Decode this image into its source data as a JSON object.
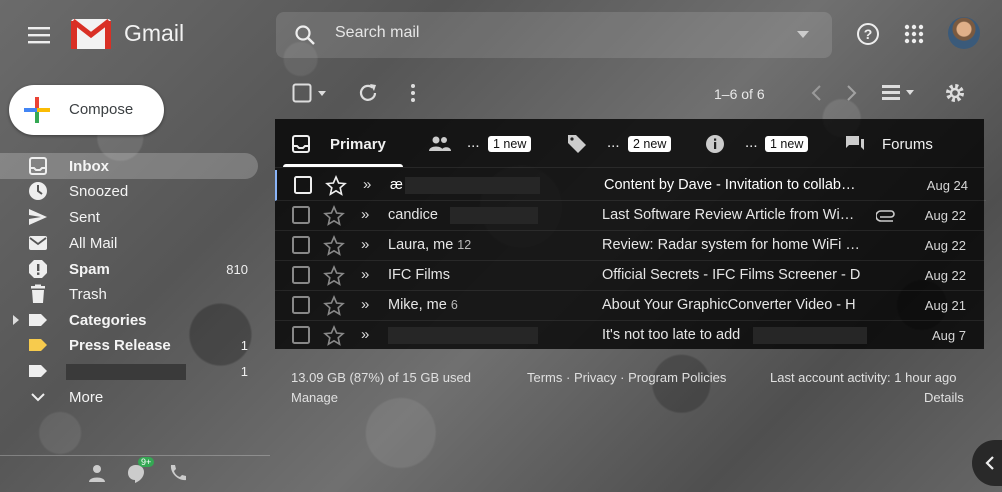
{
  "header": {
    "brand": "Gmail",
    "search_placeholder": "Search mail",
    "icons": [
      "menu-icon",
      "gmail-logo",
      "search-icon",
      "search-options-icon",
      "help-icon",
      "apps-icon",
      "avatar"
    ]
  },
  "compose": {
    "label": "Compose"
  },
  "sidebar": {
    "items": [
      {
        "label": "Inbox",
        "icon": "inbox-icon",
        "bold": true,
        "active": true,
        "count": ""
      },
      {
        "label": "Snoozed",
        "icon": "clock-icon",
        "bold": false,
        "count": ""
      },
      {
        "label": "Sent",
        "icon": "send-icon",
        "bold": false,
        "count": ""
      },
      {
        "label": "All Mail",
        "icon": "mail-icon",
        "bold": false,
        "count": ""
      },
      {
        "label": "Spam",
        "icon": "spam-icon",
        "bold": true,
        "count": "810"
      },
      {
        "label": "Trash",
        "icon": "trash-icon",
        "bold": false,
        "count": ""
      },
      {
        "label": "Categories",
        "icon": "label-icon",
        "bold": true,
        "count": ""
      },
      {
        "label": "Press Release",
        "icon": "label-icon",
        "bold": true,
        "count": "1",
        "color": "#f7cb4d"
      },
      {
        "label": "",
        "icon": "label-icon",
        "bold": false,
        "count": "1",
        "redacted": true
      },
      {
        "label": "More",
        "icon": "chevron-down-icon",
        "bold": false,
        "count": ""
      }
    ]
  },
  "toolbar": {
    "pager": "1–6 of 6"
  },
  "tabs": [
    {
      "label": "Primary",
      "icon": "inbox-tab-icon",
      "badge": ""
    },
    {
      "label": "...",
      "icon": "people-icon",
      "badge": "1 new"
    },
    {
      "label": "...",
      "icon": "tag-icon",
      "badge": "2 new"
    },
    {
      "label": "...",
      "icon": "info-icon",
      "badge": "1 new"
    },
    {
      "label": "Forums",
      "icon": "forum-icon",
      "badge": ""
    }
  ],
  "emails": [
    {
      "sender": "æ",
      "count": "",
      "subject": "Content by Dave - Invitation to collab…",
      "date": "Aug 24",
      "attachment": false
    },
    {
      "sender": "candice",
      "count": "",
      "subject": "Last Software Review Article from Wi…",
      "date": "Aug 22",
      "attachment": true
    },
    {
      "sender": "Laura, me",
      "count": "12",
      "subject": "Review: Radar system for home WiFi …",
      "date": "Aug 22",
      "attachment": false
    },
    {
      "sender": "IFC Films",
      "count": "",
      "subject": "Official Secrets - IFC Films Screener - D",
      "date": "Aug 22",
      "attachment": false
    },
    {
      "sender": "Mike, me",
      "count": "6",
      "subject": "About Your GraphicConverter Video - H",
      "date": "Aug 21",
      "attachment": false
    },
    {
      "sender": "",
      "count": "",
      "subject": "It's not too late to add",
      "date": "Aug 7",
      "attachment": false
    }
  ],
  "footer": {
    "storage": "13.09 GB (87%) of 15 GB used",
    "manage": "Manage",
    "terms": "Terms · Privacy · Program Policies",
    "activity": "Last account activity: 1 hour ago",
    "details": "Details"
  },
  "hangouts": {
    "badge": "9+"
  },
  "colors": {
    "accent": "#8ab4f8",
    "panel": "#000000",
    "label_press_release": "#f7cb4d"
  }
}
